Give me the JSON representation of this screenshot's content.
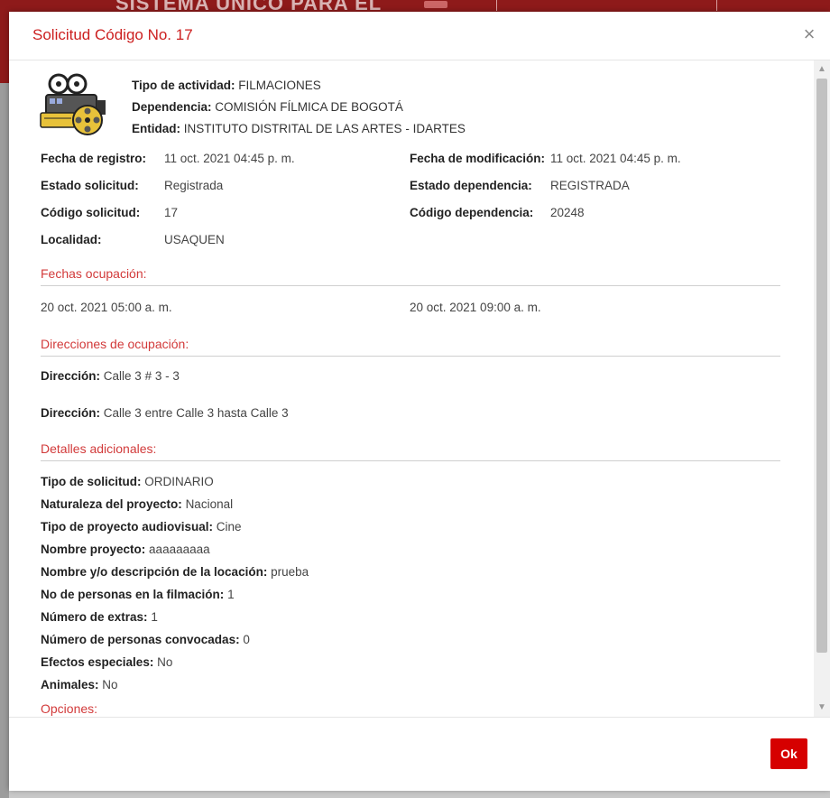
{
  "background": {
    "title": "SISTEMA ÚNICO PARA EL",
    "accent_color": "#8e1a1a"
  },
  "dialog": {
    "title": "Solicitud Código No. 17",
    "close_label": "×",
    "ok_label": "Ok",
    "ok_color": "#d60000",
    "accent_color": "#cc1f1f"
  },
  "header_info": {
    "tipo_actividad": {
      "label": "Tipo de actividad:",
      "value": "FILMACIONES"
    },
    "dependencia": {
      "label": "Dependencia:",
      "value": "COMISIÓN FÍLMICA DE BOGOTÁ"
    },
    "entidad": {
      "label": "Entidad:",
      "value": "INSTITUTO DISTRITAL DE LAS ARTES - IDARTES"
    },
    "icon": "film-camera-icon"
  },
  "details": {
    "fecha_registro": {
      "label": "Fecha de registro:",
      "value": "11 oct. 2021 04:45 p. m."
    },
    "fecha_modificacion": {
      "label": "Fecha de modificación:",
      "value": "11 oct. 2021 04:45 p. m."
    },
    "estado_solicitud": {
      "label": "Estado solicitud:",
      "value": "Registrada"
    },
    "estado_dependencia": {
      "label": "Estado dependencia:",
      "value": "REGISTRADA"
    },
    "codigo_solicitud": {
      "label": "Código solicitud:",
      "value": "17"
    },
    "codigo_dependencia": {
      "label": "Código dependencia:",
      "value": "20248"
    },
    "localidad": {
      "label": "Localidad:",
      "value": "USAQUEN"
    }
  },
  "fechas": {
    "title": "Fechas ocupación:",
    "start": "20 oct. 2021 05:00 a. m.",
    "end": "20 oct. 2021 09:00 a. m."
  },
  "direcciones": {
    "title": "Direcciones de ocupación:",
    "items": [
      {
        "label": "Dirección:",
        "value": "Calle 3 # 3 - 3"
      },
      {
        "label": "Dirección:",
        "value": "Calle 3 entre Calle 3 hasta Calle 3"
      }
    ]
  },
  "adicionales": {
    "title": "Detalles adicionales:",
    "items": [
      {
        "label": "Tipo de solicitud:",
        "value": "ORDINARIO"
      },
      {
        "label": "Naturaleza del proyecto:",
        "value": "Nacional"
      },
      {
        "label": "Tipo de proyecto audiovisual:",
        "value": "Cine"
      },
      {
        "label": "Nombre proyecto:",
        "value": "aaaaaaaaa"
      },
      {
        "label": "Nombre y/o descripción de la locación:",
        "value": "prueba"
      },
      {
        "label": "No de personas en la filmación:",
        "value": "1"
      },
      {
        "label": "Número de extras:",
        "value": "1"
      },
      {
        "label": "Número de personas convocadas:",
        "value": "0"
      },
      {
        "label": "Efectos especiales:",
        "value": "No"
      },
      {
        "label": "Animales:",
        "value": "No"
      }
    ]
  },
  "opciones": {
    "title": "Opciones:"
  }
}
